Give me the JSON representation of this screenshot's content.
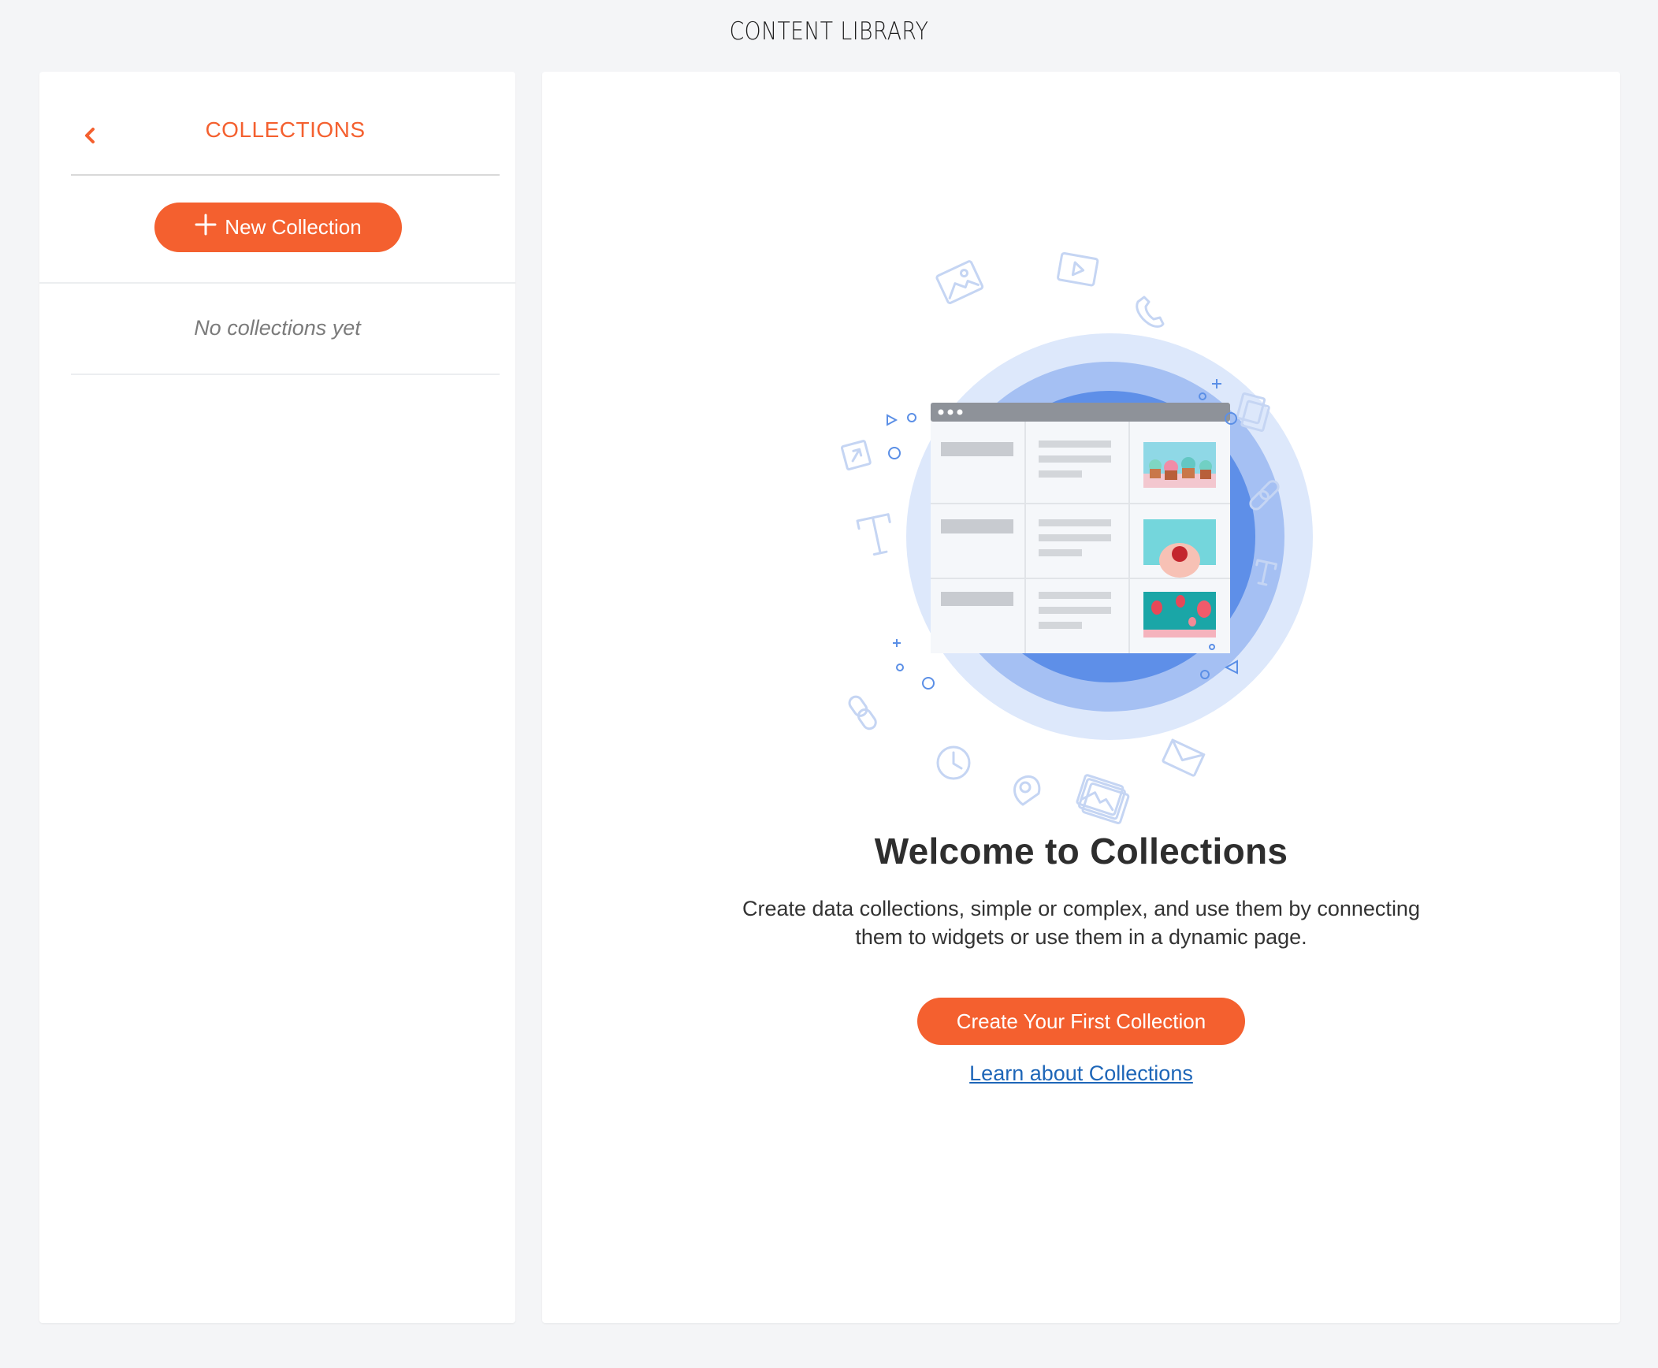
{
  "page": {
    "title": "CONTENT LIBRARY"
  },
  "sidebar": {
    "title": "COLLECTIONS",
    "back_icon": "chevron-left-icon",
    "new_button_label": "New Collection",
    "new_button_icon": "plus-icon",
    "empty_text": "No collections yet"
  },
  "main": {
    "welcome_title": "Welcome to Collections",
    "description_line1": "Create data collections, simple or complex, and use them by connecting",
    "description_line2": "them to widgets or use them in a dynamic page.",
    "create_button_label": "Create Your First Collection",
    "learn_link": "Learn about Collections"
  },
  "colors": {
    "accent": "#f4602f",
    "link": "#1e66b8",
    "background": "#f4f5f7"
  }
}
